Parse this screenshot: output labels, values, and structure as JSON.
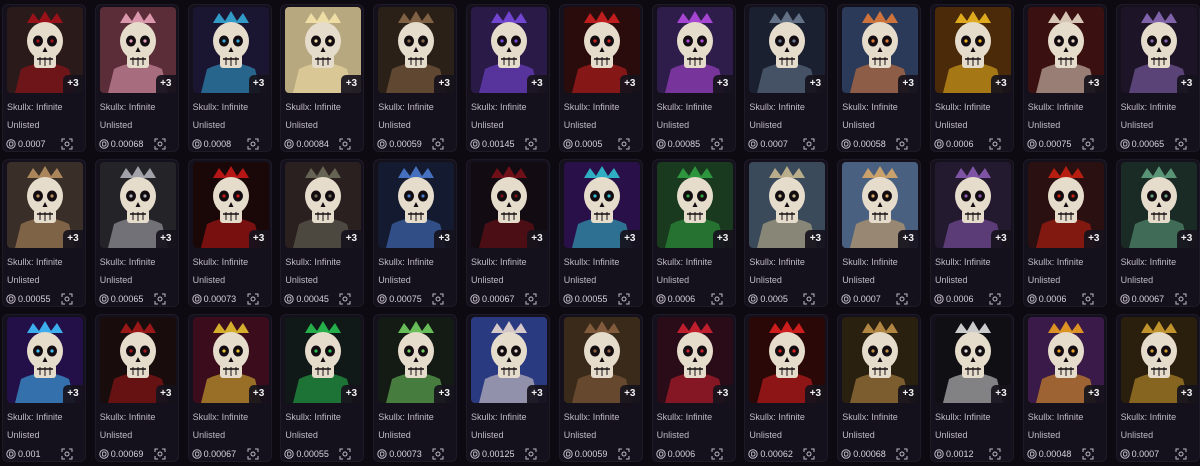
{
  "collection_name": "Skullx: Infinite",
  "status_text": "Unlisted",
  "badge_text": "+3",
  "items": [
    {
      "price": "0.0007",
      "bg": "#2b1a1a",
      "accent": "#a5121a"
    },
    {
      "price": "0.00068",
      "bg": "#5a2d38",
      "accent": "#e8a3b8"
    },
    {
      "price": "0.0008",
      "bg": "#1a1530",
      "accent": "#35a8d8"
    },
    {
      "price": "0.00084",
      "bg": "#b8a880",
      "accent": "#f4e2a8"
    },
    {
      "price": "0.00059",
      "bg": "#2a2018",
      "accent": "#8a6848"
    },
    {
      "price": "0.00145",
      "bg": "#2a1a48",
      "accent": "#7a4ae0"
    },
    {
      "price": "0.0005",
      "bg": "#2a0c0c",
      "accent": "#d02020"
    },
    {
      "price": "0.00085",
      "bg": "#2e1c4a",
      "accent": "#b44ae0"
    },
    {
      "price": "0.0007",
      "bg": "#1a2030",
      "accent": "#6a7a90"
    },
    {
      "price": "0.00058",
      "bg": "#2a3a58",
      "accent": "#e07a3a"
    },
    {
      "price": "0.0006",
      "bg": "#4a2a08",
      "accent": "#f0b820"
    },
    {
      "price": "0.00075",
      "bg": "#3a1010",
      "accent": "#e8d8c8"
    },
    {
      "price": "0.00065",
      "bg": "#1e1428",
      "accent": "#8a6ab8"
    },
    {
      "price": "0.00055",
      "bg": "#3a2e28",
      "accent": "#b89060"
    },
    {
      "price": "0.00065",
      "bg": "#242428",
      "accent": "#b0b0b8"
    },
    {
      "price": "0.00073",
      "bg": "#1a0808",
      "accent": "#c81818"
    },
    {
      "price": "0.00045",
      "bg": "#2a2020",
      "accent": "#6a6a5a"
    },
    {
      "price": "0.00075",
      "bg": "#141a30",
      "accent": "#4a7ad0"
    },
    {
      "price": "0.00067",
      "bg": "#120c12",
      "accent": "#7a1018"
    },
    {
      "price": "0.00055",
      "bg": "#2a1048",
      "accent": "#30c0d0"
    },
    {
      "price": "0.0006",
      "bg": "#1a3a20",
      "accent": "#30a040"
    },
    {
      "price": "0.0005",
      "bg": "#3a4a5a",
      "accent": "#c8b890"
    },
    {
      "price": "0.0007",
      "bg": "#4a6080",
      "accent": "#d8a868"
    },
    {
      "price": "0.0006",
      "bg": "#241a30",
      "accent": "#8a5ab0"
    },
    {
      "price": "0.0006",
      "bg": "#2a1010",
      "accent": "#c82010"
    },
    {
      "price": "0.00067",
      "bg": "#1a2a24",
      "accent": "#60a080"
    },
    {
      "price": "0.001",
      "bg": "#241048",
      "accent": "#40c0ff"
    },
    {
      "price": "0.00069",
      "bg": "#180c0c",
      "accent": "#a81818"
    },
    {
      "price": "0.00067",
      "bg": "#3a0c1c",
      "accent": "#e8c030"
    },
    {
      "price": "0.00055",
      "bg": "#101818",
      "accent": "#28c050"
    },
    {
      "price": "0.00073",
      "bg": "#141a14",
      "accent": "#70d060"
    },
    {
      "price": "0.00125",
      "bg": "#2a3a80",
      "accent": "#e8d8d0"
    },
    {
      "price": "0.00059",
      "bg": "#3a2a1a",
      "accent": "#8a6040"
    },
    {
      "price": "0.0006",
      "bg": "#2a0c18",
      "accent": "#d02030"
    },
    {
      "price": "0.00062",
      "bg": "#2a0808",
      "accent": "#e02020"
    },
    {
      "price": "0.00068",
      "bg": "#2a2010",
      "accent": "#c09048"
    },
    {
      "price": "0.0012",
      "bg": "#101014",
      "accent": "#e0e0e0"
    },
    {
      "price": "0.00048",
      "bg": "#3a1a48",
      "accent": "#f0a020"
    },
    {
      "price": "0.0007",
      "bg": "#2a1e0c",
      "accent": "#d0a030"
    }
  ]
}
